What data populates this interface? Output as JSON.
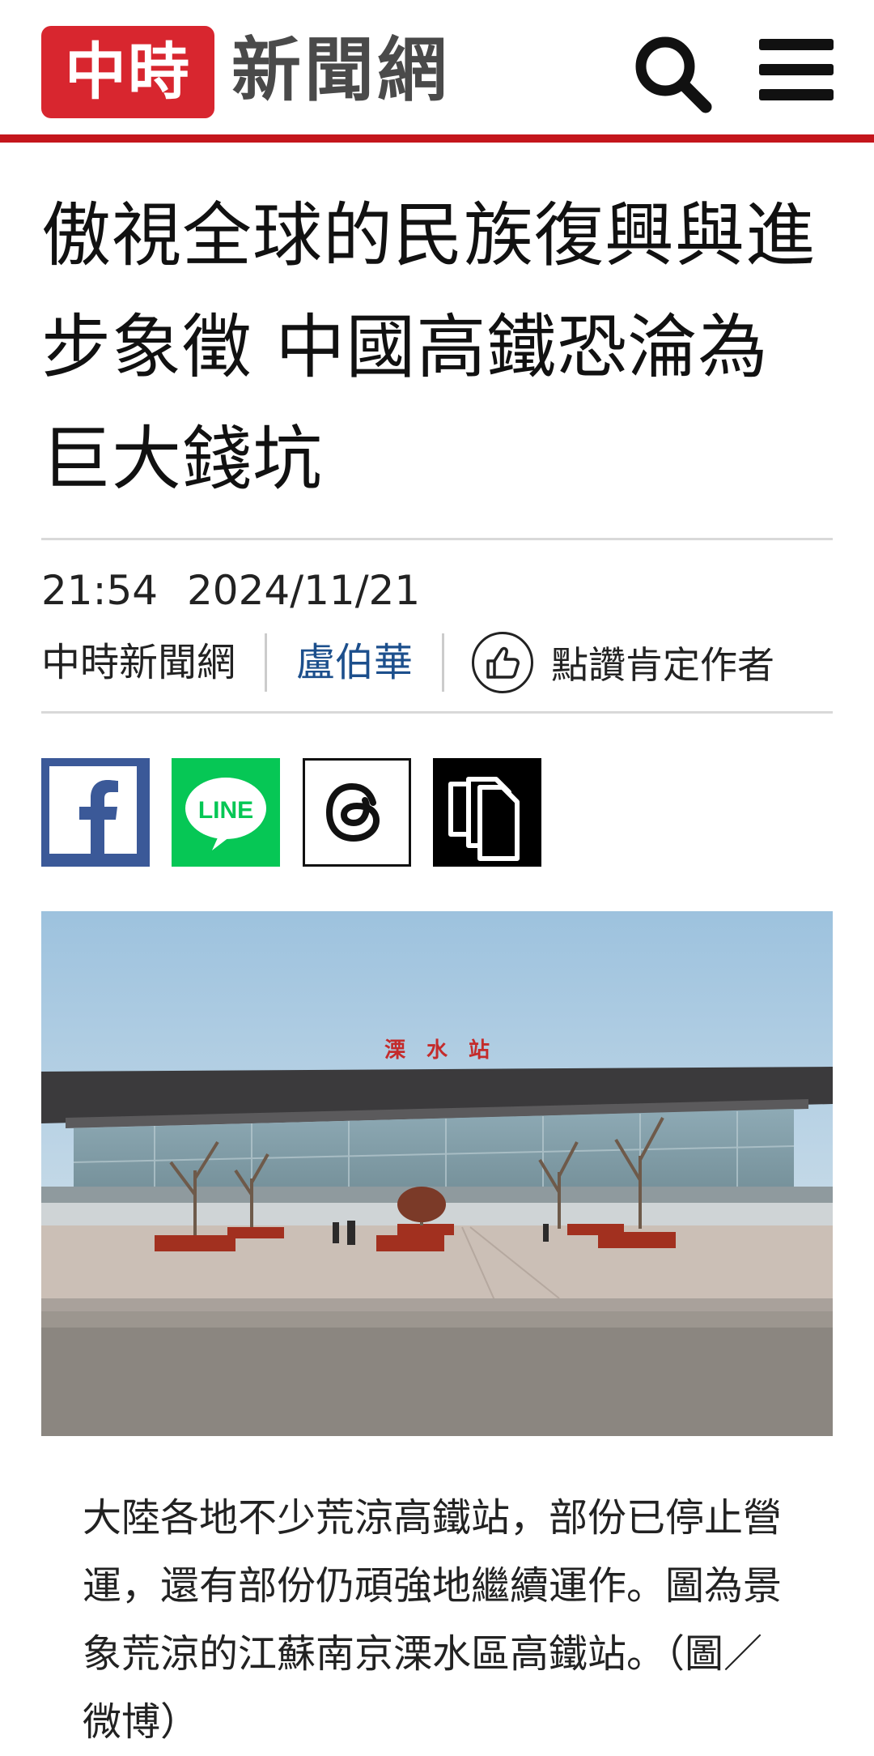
{
  "header": {
    "logo_mark": "中時",
    "logo_text": "新聞網",
    "brand_color": "#c4161c",
    "logo_red": "#d8262f"
  },
  "article": {
    "title": "傲視全球的民族復興與進步象徵 中國高鐵恐淪為巨大錢坑",
    "time": "21:54",
    "date": "2024/11/21",
    "source": "中時新聞網",
    "author": "盧伯華",
    "like_label": "點讚肯定作者",
    "author_color": "#1c4f8c"
  },
  "share": {
    "facebook_icon": "facebook-icon",
    "line_label": "LINE",
    "threads_icon": "threads-icon",
    "copy_icon": "copy-icon"
  },
  "photo": {
    "station_sign": "溧　水　站"
  },
  "caption": "大陸各地不少荒涼高鐵站，部份已停止營運，還有部份仍頑強地繼續運作。圖為景象荒涼的江蘇南京溧水區高鐵站。（圖／微博）"
}
